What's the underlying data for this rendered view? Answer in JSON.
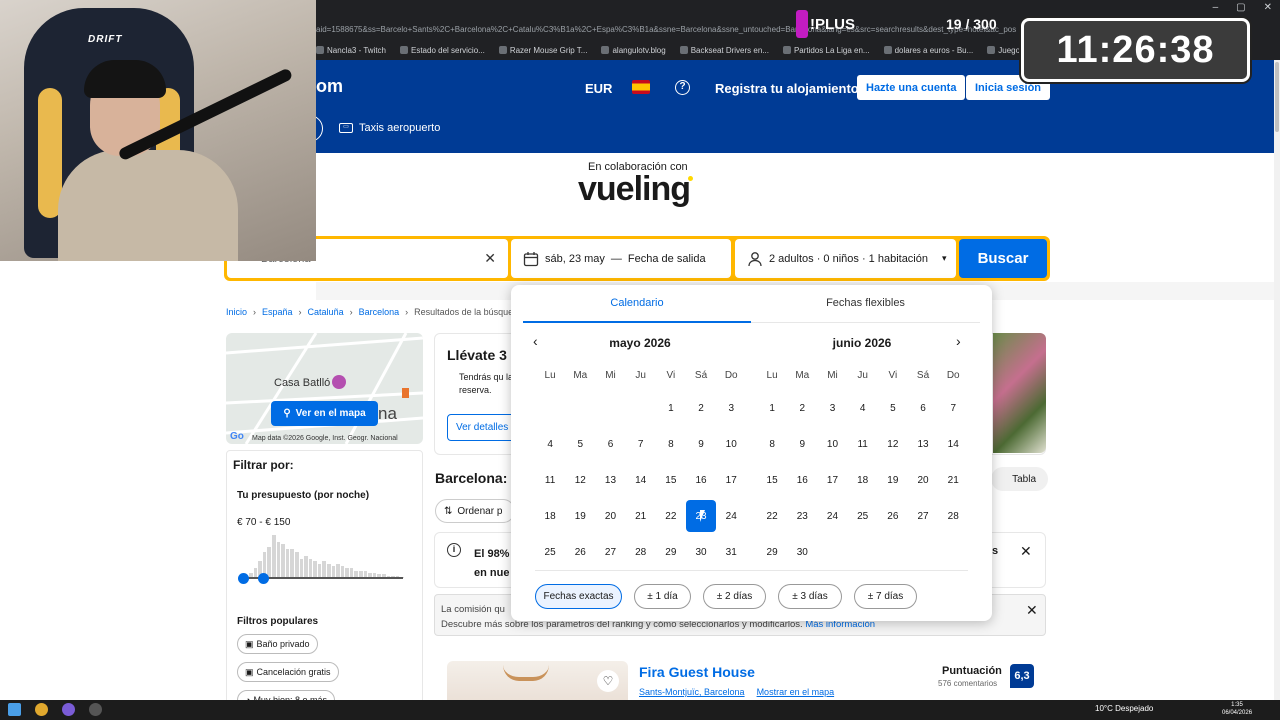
{
  "browser": {
    "url": "aid=1588675&ss=Barcelo+Sants%2C+Barcelona%2C+Catalu%C3%B1a%2C+Espa%C3%B1a&ssne=Barcelona&ssne_untouched=Barcelona&lang=es&src=searchresults&dest_type=hotel&ac_position=3&ac_click_type=b&ac_",
    "bookmarks": [
      "Nancla3 - Twitch",
      "Estado del servicio...",
      "Razer Mouse Grip T...",
      "alangulotv.blog",
      "Backseat Drivers en...",
      "Partidos La Liga en...",
      "dolares a euros - Bu...",
      "Juego de Trivia en li..."
    ],
    "window_controls": [
      "–",
      "▢",
      "✕"
    ]
  },
  "overlay": {
    "plus_label": "!PLUS",
    "counter": "19 / 300",
    "clock": "11:26:38",
    "chair_brand": "DRIFT"
  },
  "header": {
    "logo_fragment": "om",
    "currency": "EUR",
    "help": "?",
    "register": "Registra tu alojamiento",
    "create_account": "Hazte una cuenta",
    "login": "Inicia sesión",
    "taxi": "Taxis aeropuerto"
  },
  "partner": {
    "collab": "En colaboración con",
    "brand": "vueling"
  },
  "search": {
    "destination": "Barcelona",
    "checkin": "sáb, 23 may",
    "dash": "—",
    "checkout": "Fecha de salida",
    "guests": "2 adultos · 0 niños · 1 habitación",
    "button": "Buscar"
  },
  "breadcrumb": [
    "Inicio",
    "España",
    "Cataluña",
    "Barcelona",
    "Resultados de la búsque"
  ],
  "sidebar": {
    "map_label": "Casa Batlló",
    "map_label2": "na",
    "map_button": "Ver en el mapa",
    "map_copyright": "Map data ©2026 Google, Inst. Geogr. Nacional",
    "filter_title": "Filtrar por:",
    "budget_title": "Tu presupuesto (por noche)",
    "budget_range": "€ 70 - € 150",
    "histogram": [
      0.05,
      0.05,
      0.1,
      0.2,
      0.35,
      0.55,
      0.65,
      0.9,
      0.75,
      0.7,
      0.6,
      0.6,
      0.55,
      0.4,
      0.45,
      0.4,
      0.35,
      0.3,
      0.35,
      0.3,
      0.25,
      0.3,
      0.25,
      0.2,
      0.2,
      0.15,
      0.15,
      0.15,
      0.1,
      0.1,
      0.08,
      0.08,
      0.05,
      0.05,
      0.04,
      0.03
    ],
    "popular_title": "Filtros populares",
    "chips": [
      "Baño privado",
      "Cancelación gratis",
      "Muy bien: 8 o más"
    ]
  },
  "promo": {
    "title": "Llévate 3",
    "text": "Tendrás qu la reserva.",
    "button": "Ver detalles"
  },
  "results": {
    "title": "Barcelona:",
    "sort": "Ordenar p",
    "table": "Tabla",
    "notice_line1": "El 98%",
    "notice_line2": "en nue",
    "notice_tail": "s",
    "commission_line1": "La comisión qu",
    "commission_line2": "Descubre más sobre los parámetros del ranking y cómo seleccionarlos y modificarlos.",
    "commission_link": "Más información"
  },
  "hotel": {
    "name": "Fira Guest House",
    "area": "Sants-Montjuïc, Barcelona",
    "map_link": "Mostrar en el mapa",
    "score_label": "Puntuación",
    "reviews": "576 comentarios",
    "score": "6,3"
  },
  "calendar": {
    "tabs": [
      "Calendario",
      "Fechas flexibles"
    ],
    "weekdays": [
      "Lu",
      "Ma",
      "Mi",
      "Ju",
      "Vi",
      "Sá",
      "Do"
    ],
    "months": [
      {
        "title": "mayo 2026",
        "offset": 4,
        "days": 31,
        "selected": 23
      },
      {
        "title": "junio 2026",
        "offset": 0,
        "days": 30,
        "selected": null
      }
    ],
    "flex_options": [
      "Fechas exactas",
      "± 1 día",
      "± 2 días",
      "± 3 días",
      "± 7 días"
    ]
  },
  "taskbar": {
    "weather": "10°C  Despejado",
    "time": "1:35",
    "date": "06/04/2026"
  }
}
